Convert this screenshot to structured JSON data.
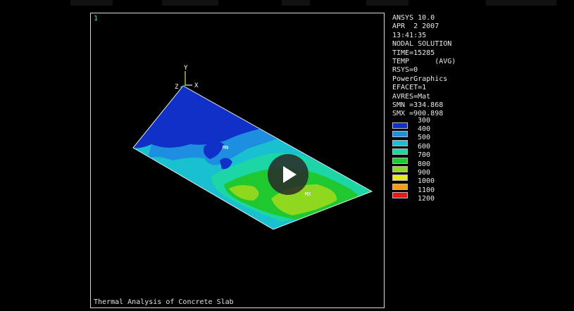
{
  "viewport": {
    "window_number": "1",
    "caption": "Thermal Analysis of Concrete Slab"
  },
  "info": {
    "lines": [
      "ANSYS 10.0",
      "APR  2 2007",
      "13:41:35",
      "NODAL SOLUTION",
      "TIME=15285",
      "TEMP      (AVG)",
      "RSYS=0",
      "PowerGraphics",
      "EFACET=1",
      "AVRES=Mat",
      "SMN =334.868",
      "SMX =900.898"
    ]
  },
  "legend": {
    "top_label": "300",
    "items": [
      {
        "label": "400",
        "color": "#1030c8"
      },
      {
        "label": "500",
        "color": "#1e8ee0"
      },
      {
        "label": "600",
        "color": "#18c0d0"
      },
      {
        "label": "700",
        "color": "#1cd6a6"
      },
      {
        "label": "800",
        "color": "#20c830"
      },
      {
        "label": "900",
        "color": "#90d820"
      },
      {
        "label": "1000",
        "color": "#e8e820"
      },
      {
        "label": "1100",
        "color": "#f0a010"
      },
      {
        "label": "1200",
        "color": "#e81818"
      }
    ],
    "last_color": "#e81818"
  },
  "axes": {
    "y": "Y",
    "z": "Z",
    "x": "X"
  },
  "markers": {
    "min": "MN",
    "max": "MX"
  },
  "video": {
    "play_icon": "play-icon"
  }
}
